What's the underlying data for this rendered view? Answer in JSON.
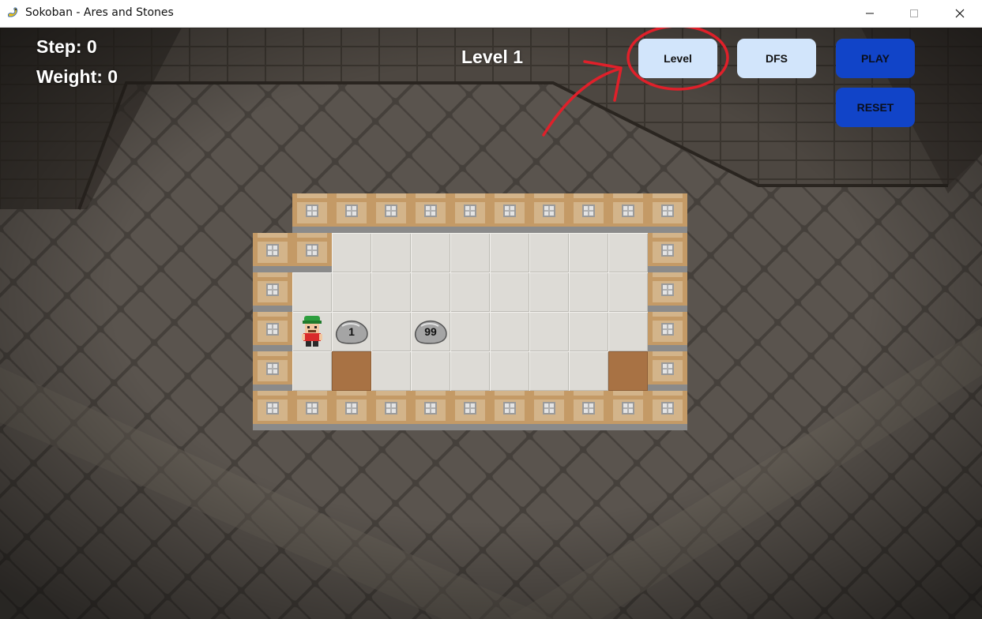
{
  "window": {
    "title": "Sokoban - Ares and Stones",
    "minimize_icon": "—",
    "maximize_icon": "☐",
    "close_icon": "✕"
  },
  "hud": {
    "step": "Step: 0",
    "weight": "Weight: 0",
    "level_title": "Level 1"
  },
  "buttons": {
    "level": "Level",
    "algorithm": "DFS",
    "play": "PLAY",
    "reset": "RESET"
  },
  "colors": {
    "light_button": "#d2e5fb",
    "dark_button": "#1144c8",
    "annotation": "#e0202a",
    "goal_tile": "#a87244",
    "floor_tile": "#dddbd6",
    "wall_wood": "#d3b48a"
  },
  "board": {
    "rows": [
      " ##########",
      "##        #",
      "#         #",
      "#@$ $     #",
      "# .      .#",
      "###########"
    ],
    "legend": {
      "#": "wall",
      " ": "floor",
      "@": "player",
      "$": "stone",
      ".": "goal"
    },
    "stone_weights": [
      "1",
      "99"
    ]
  }
}
